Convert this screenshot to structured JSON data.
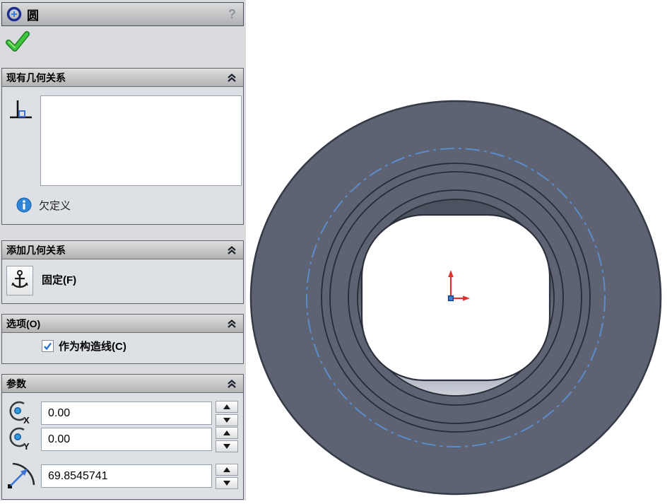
{
  "panel": {
    "title": {
      "label": "圆",
      "help": "?"
    },
    "ok_button": "confirm-green-check",
    "sections": {
      "existing_relations": {
        "header": "现有几何关系",
        "listbox_items": [],
        "status": "欠定义"
      },
      "add_relations": {
        "header": "添加几何关系",
        "fix_label": "固定(F)"
      },
      "options": {
        "header": "选项(O)",
        "construction_label": "作为构造线(C)",
        "construction_checked": true
      },
      "parameters": {
        "header": "参数",
        "x": {
          "value": "0.00"
        },
        "y": {
          "value": "0.00"
        },
        "radius": {
          "value": "69.8545741"
        }
      }
    }
  },
  "icons": {
    "tool": "circle-sketch-icon",
    "relation": "perpendicular-icon",
    "status": "info-icon",
    "fix": "anchor-icon",
    "center_x_label": "X",
    "center_y_label": "Y",
    "radius": "radius-arrow-icon"
  },
  "colors": {
    "panel_background": "#d9dbde",
    "group_header_gradient_top": "#dedede",
    "group_header_gradient_bottom": "#b3b3b3",
    "model_gray": "#5d6373",
    "edge_dark": "#262b36",
    "construction_blue": "#5c8ccb",
    "origin_red": "#e03131",
    "origin_blue": "#3f80d8",
    "check_green": "#2aa52a"
  },
  "viewport": {
    "background": "#ffffff"
  }
}
